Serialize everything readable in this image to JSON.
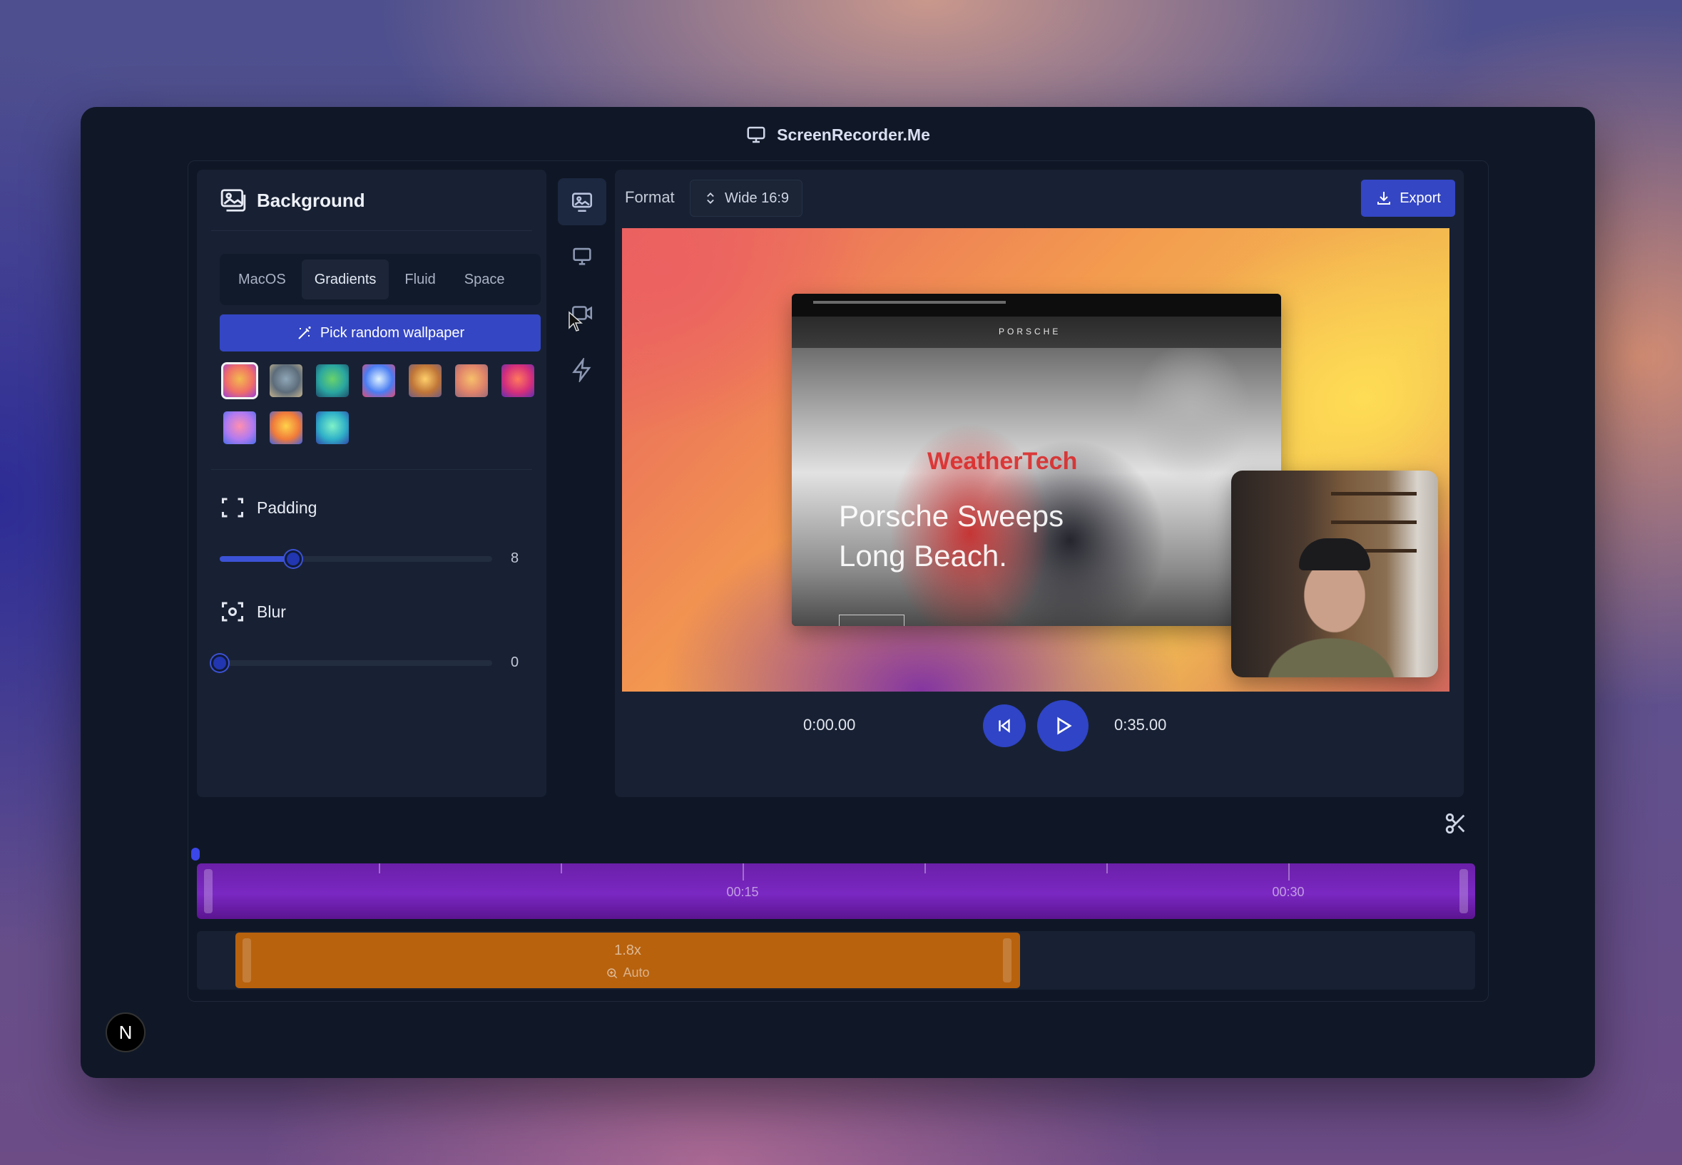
{
  "app": {
    "title": "ScreenRecorder.Me",
    "title_icon": "monitor-icon"
  },
  "left_panel": {
    "title": "Background",
    "tabs": [
      {
        "label": "MacOS",
        "active": false
      },
      {
        "label": "Gradients",
        "active": true
      },
      {
        "label": "Fluid",
        "active": false
      },
      {
        "label": "Space",
        "active": false
      }
    ],
    "random_button": "Pick random wallpaper",
    "wallpapers": [
      {
        "colors": [
          "#f3ba4f",
          "#f06e67",
          "#9c3fd8"
        ],
        "selected": true
      },
      {
        "colors": [
          "#8fa7b8",
          "#5d6c7a",
          "#c6b48e"
        ],
        "selected": false
      },
      {
        "colors": [
          "#69d36b",
          "#2aa6a0",
          "#1d4e6e"
        ],
        "selected": false
      },
      {
        "colors": [
          "#dff2ff",
          "#4a7df2",
          "#e04b74"
        ],
        "selected": false
      },
      {
        "colors": [
          "#ffcf6a",
          "#c07638",
          "#6f5b86"
        ],
        "selected": false
      },
      {
        "colors": [
          "#f7c06b",
          "#e0846a",
          "#9b6a7a"
        ],
        "selected": false
      },
      {
        "colors": [
          "#ff7a5c",
          "#d62f7a",
          "#5f2fb0"
        ],
        "selected": false
      },
      {
        "colors": [
          "#ff8fb0",
          "#b27af0",
          "#4a6ee8"
        ],
        "selected": false
      },
      {
        "colors": [
          "#ffd24a",
          "#f07a3a",
          "#3a62e8"
        ],
        "selected": false
      },
      {
        "colors": [
          "#7ff2c8",
          "#2fb0c8",
          "#2f48a8"
        ],
        "selected": false
      }
    ],
    "padding": {
      "label": "Padding",
      "value": "8",
      "fraction": 0.27
    },
    "blur": {
      "label": "Blur",
      "value": "0",
      "fraction": 0
    }
  },
  "tools": [
    {
      "name": "background-tool",
      "icon": "image-icon",
      "active": true
    },
    {
      "name": "screen-tool",
      "icon": "monitor-icon",
      "active": false
    },
    {
      "name": "camera-tool",
      "icon": "video-camera-icon",
      "active": false
    },
    {
      "name": "effects-tool",
      "icon": "lightning-icon",
      "active": false
    }
  ],
  "preview": {
    "format_label": "Format",
    "format_value": "Wide 16:9",
    "export_label": "Export",
    "capture_brand": "PORSCHE",
    "capture_banner": "WeatherTech",
    "capture_headline": "Porsche Sweeps Long Beach.",
    "time_current": "0:00.00",
    "time_total": "0:35.00"
  },
  "timeline": {
    "ticks": [
      "00:15",
      "00:30"
    ],
    "zoom_speed": "1.8x",
    "zoom_mode": "Auto"
  },
  "badge": "N"
}
